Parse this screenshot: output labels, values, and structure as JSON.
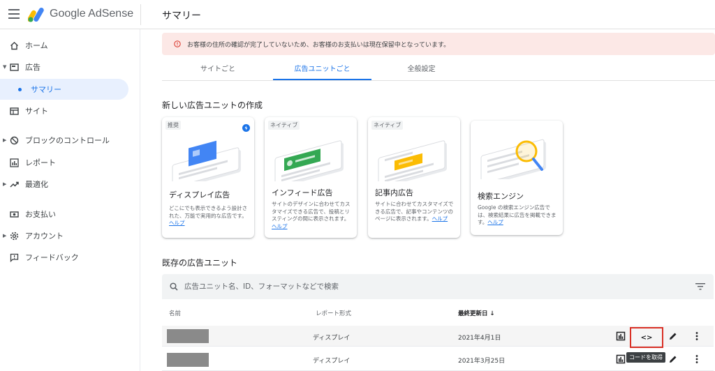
{
  "header": {
    "app_name": "Google AdSense",
    "page_title": "サマリー"
  },
  "sidebar": {
    "items": [
      {
        "label": "ホーム",
        "icon": "home-icon"
      },
      {
        "label": "広告",
        "icon": "ads-icon"
      },
      {
        "label": "サマリー",
        "icon": "dot"
      },
      {
        "label": "サイト",
        "icon": "sites-icon"
      },
      {
        "label": "ブロックのコントロール",
        "icon": "block-icon"
      },
      {
        "label": "レポート",
        "icon": "report-icon"
      },
      {
        "label": "最適化",
        "icon": "trending-icon"
      },
      {
        "label": "お支払い",
        "icon": "payments-icon"
      },
      {
        "label": "アカウント",
        "icon": "gear-icon"
      },
      {
        "label": "フィードバック",
        "icon": "feedback-icon"
      }
    ]
  },
  "alert": {
    "text": "お客様の住所の確認が完了していないため、お客様のお支払いは現在保留中となっています。"
  },
  "tabs": [
    {
      "label": "サイトごと"
    },
    {
      "label": "広告ユニットごと"
    },
    {
      "label": "全般設定"
    }
  ],
  "create_section": {
    "title": "新しい広告ユニットの作成",
    "cards": [
      {
        "badge": "推奨",
        "title": "ディスプレイ広告",
        "desc": "どこにでも表示できるよう設計された、万能で実用的な広告です。",
        "link": "ヘルプ"
      },
      {
        "badge": "ネイティブ",
        "title": "インフィード広告",
        "desc": "サイトのデザインに合わせてカスタマイズできる広告で、投稿とリスティングの間に表示されます。",
        "link": "ヘルプ"
      },
      {
        "badge": "ネイティブ",
        "title": "記事内広告",
        "desc": "サイトに合わせてカスタマイズできる広告で、記事やコンテンツのページに表示されます。",
        "link": "ヘルプ"
      },
      {
        "badge": "",
        "title": "検索エンジン",
        "desc": "Google の検索エンジン広告では、検索結果に広告を掲載できます。",
        "link": "ヘルプ"
      }
    ]
  },
  "existing_section": {
    "title": "既存の広告ユニット",
    "search_placeholder": "広告ユニット名、ID、フォーマットなどで検索",
    "columns": {
      "name": "名前",
      "report_format": "レポート形式",
      "last_updated": "最終更新日 ↓"
    },
    "rows": [
      {
        "report_format": "ディスプレイ",
        "last_updated": "2021年4月1日"
      },
      {
        "report_format": "ディスプレイ",
        "last_updated": "2021年3月25日"
      }
    ],
    "get_code_symbol": "<>",
    "tooltip": "コードを取得"
  },
  "colors": {
    "accent": "#1a73e8",
    "alert_bg": "#fce8e6",
    "highlight_border": "#d93025"
  }
}
